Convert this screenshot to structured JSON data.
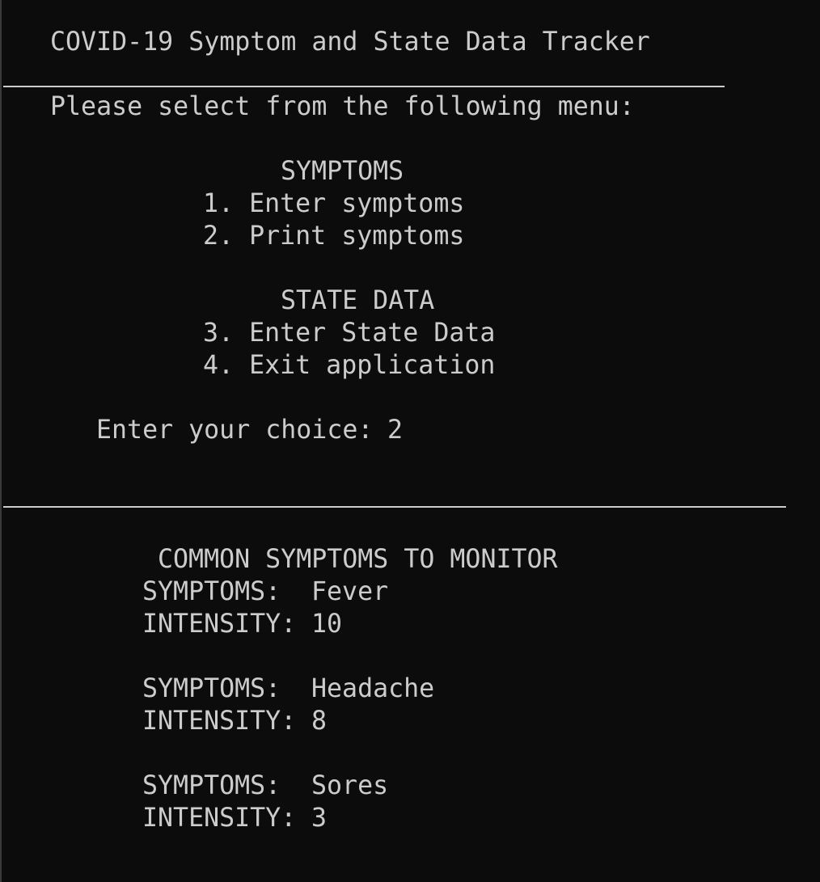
{
  "app_title": "COVID-19 Symptom and State Data Tracker",
  "menu": {
    "prompt": "Please select from the following menu:",
    "symptoms_heading": "SYMPTOMS",
    "options": [
      "1. Enter symptoms",
      "2. Print symptoms",
      "3. Enter State Data",
      "4. Exit application"
    ],
    "state_heading": "STATE DATA"
  },
  "choice": {
    "label": "Enter your choice:",
    "value": "2"
  },
  "report": {
    "heading": "COMMON SYMPTOMS TO MONITOR",
    "symptom_label": "SYMPTOMS:",
    "intensity_label": "INTENSITY:",
    "entries": [
      {
        "symptom": "Fever",
        "intensity": "10"
      },
      {
        "symptom": "Headache",
        "intensity": "8"
      },
      {
        "symptom": "Sores",
        "intensity": "3"
      }
    ]
  }
}
